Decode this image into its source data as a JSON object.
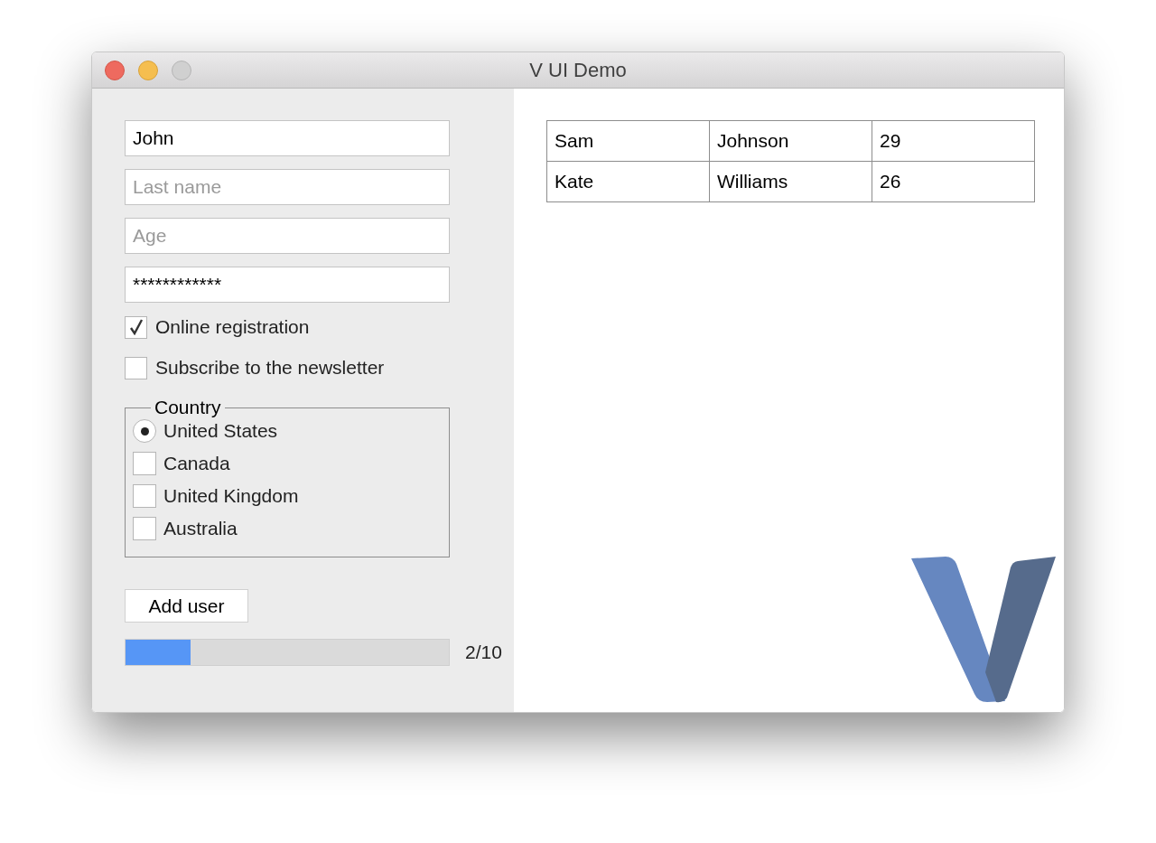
{
  "window": {
    "title": "V UI Demo"
  },
  "fields": [
    {
      "value": "John"
    },
    {
      "placeholder": "Last name"
    },
    {
      "placeholder": "Age"
    },
    {
      "value": "************"
    }
  ],
  "checkboxes": [
    {
      "label": "Online registration",
      "checked": true
    },
    {
      "label": "Subscribe to the newsletter",
      "checked": false
    }
  ],
  "country": {
    "legend": "Country",
    "options": [
      {
        "label": "United States",
        "selected": true
      },
      {
        "label": "Canada",
        "selected": false
      },
      {
        "label": "United Kingdom",
        "selected": false
      },
      {
        "label": "Australia",
        "selected": false
      }
    ]
  },
  "add_button": "Add user",
  "progress": {
    "level": 0.2,
    "reading": "2/10"
  },
  "table": {
    "rows": [
      [
        "Sam",
        "Johnson",
        "29"
      ],
      [
        "Kate",
        "Williams",
        "26"
      ]
    ]
  }
}
